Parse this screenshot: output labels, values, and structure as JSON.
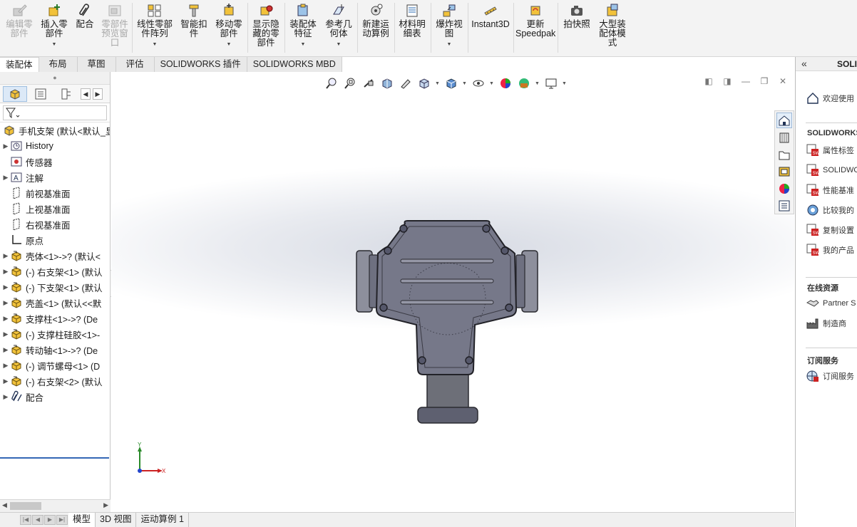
{
  "ribbon": {
    "buttons": [
      {
        "label": "编辑零部件",
        "icon": "edit-component-icon",
        "disabled": true
      },
      {
        "label": "插入零部件",
        "icon": "insert-component-icon",
        "disabled": false
      },
      {
        "label": "配合",
        "icon": "mate-paperclip-icon",
        "disabled": false
      },
      {
        "label": "零部件预览窗口",
        "icon": "component-preview-icon",
        "disabled": true
      },
      {
        "label": "线性零部件阵列",
        "icon": "linear-pattern-icon",
        "disabled": false
      },
      {
        "label": "智能扣件",
        "icon": "smart-fastener-icon",
        "disabled": false
      },
      {
        "label": "移动零部件",
        "icon": "move-component-icon",
        "disabled": false
      },
      {
        "label": "显示隐藏的零部件",
        "icon": "show-hidden-icon",
        "disabled": false
      },
      {
        "label": "装配体特征",
        "icon": "assembly-feature-icon",
        "disabled": false
      },
      {
        "label": "参考几何体",
        "icon": "reference-geometry-icon",
        "disabled": false
      },
      {
        "label": "新建运动算例",
        "icon": "motion-study-icon",
        "disabled": false
      },
      {
        "label": "材料明细表",
        "icon": "bom-icon",
        "disabled": false
      },
      {
        "label": "爆炸视图",
        "icon": "exploded-view-icon",
        "disabled": false
      },
      {
        "label": "Instant3D",
        "icon": "instant3d-icon",
        "disabled": false
      },
      {
        "label": "更新Speedpak",
        "icon": "speedpak-icon",
        "disabled": false
      },
      {
        "label": "拍快照",
        "icon": "snapshot-camera-icon",
        "disabled": false
      },
      {
        "label": "大型装配体模式",
        "icon": "large-assembly-icon",
        "disabled": false
      }
    ]
  },
  "command_tabs": [
    "装配体",
    "布局",
    "草图",
    "评估",
    "SOLIDWORKS 插件",
    "SOLIDWORKS MBD"
  ],
  "feature_tree": {
    "root": "手机支架 (默认<默认_显",
    "items": [
      {
        "label": "History",
        "icon": "history-icon",
        "expand": true
      },
      {
        "label": "传感器",
        "icon": "sensor-icon",
        "expand": false
      },
      {
        "label": "注解",
        "icon": "annotation-icon",
        "expand": true
      },
      {
        "label": "前视基准面",
        "icon": "plane-icon",
        "expand": false
      },
      {
        "label": "上视基准面",
        "icon": "plane-icon",
        "expand": false
      },
      {
        "label": "右视基准面",
        "icon": "plane-icon",
        "expand": false
      },
      {
        "label": "原点",
        "icon": "origin-icon",
        "expand": false
      },
      {
        "label": "壳体<1>->? (默认<",
        "icon": "part-icon",
        "expand": true
      },
      {
        "label": "(-) 右支架<1> (默认",
        "icon": "part-icon",
        "expand": true
      },
      {
        "label": "(-) 下支架<1> (默认",
        "icon": "part-icon",
        "expand": true
      },
      {
        "label": "壳盖<1> (默认<<默",
        "icon": "part-icon",
        "expand": true
      },
      {
        "label": "支撑柱<1>->? (De",
        "icon": "part-icon",
        "expand": true
      },
      {
        "label": "(-) 支撑柱硅胶<1>-",
        "icon": "part-icon",
        "expand": true
      },
      {
        "label": "转动轴<1>->? (De",
        "icon": "part-icon",
        "expand": true
      },
      {
        "label": "(-) 调节螺母<1> (D",
        "icon": "part-icon",
        "expand": true
      },
      {
        "label": "(-) 右支架<2> (默认",
        "icon": "part-icon",
        "expand": true
      },
      {
        "label": "配合",
        "icon": "mates-folder-icon",
        "expand": true
      }
    ]
  },
  "triad": {
    "y": "Y",
    "x": "X"
  },
  "taskpane": {
    "title": "SOLI",
    "welcome": "欢迎使用",
    "section_solidworks": "SOLIDWORKS",
    "sw_items": [
      "属性标签",
      "SOLIDWO",
      "性能基准",
      "比较我的",
      "复制设置",
      "我的产品"
    ],
    "section_online": "在线资源",
    "online_items": [
      "Partner S",
      "制造商"
    ],
    "section_subscription": "订阅服务",
    "subscription_items": [
      "订阅服务"
    ]
  },
  "bottom_tabs": [
    "模型",
    "3D 视图",
    "运动算例 1"
  ],
  "colors": {
    "ribbon_bg": "#f3f3f3",
    "model_body": "#7a7d90",
    "selection_line": "#3467b5"
  }
}
